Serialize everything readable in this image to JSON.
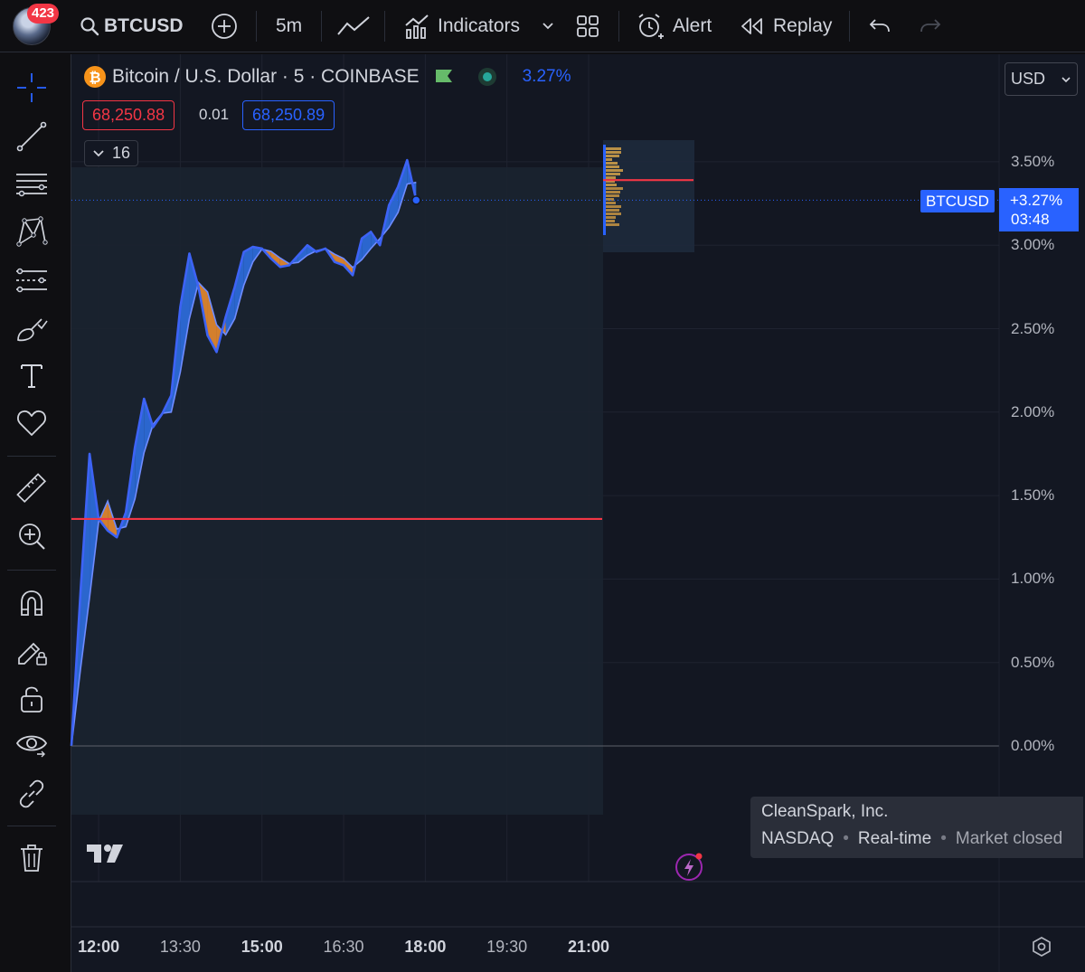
{
  "header": {
    "notification_count": "423",
    "symbol": "BTCUSD",
    "interval": "5m",
    "indicators_label": "Indicators",
    "alert_label": "Alert",
    "replay_label": "Replay"
  },
  "legend": {
    "title": "Bitcoin / U.S. Dollar · 5 · COINBASE",
    "change": "3.27%",
    "bid": "68,250.88",
    "spread": "0.01",
    "ask": "68,250.89",
    "indicator_count": "16"
  },
  "price_scale": {
    "currency": "USD",
    "labels": [
      "3.50%",
      "3.00%",
      "2.50%",
      "2.00%",
      "1.50%",
      "1.00%",
      "0.50%",
      "0.00%"
    ],
    "last_symbol": "BTCUSD",
    "last_change": "+3.27%",
    "countdown": "03:48"
  },
  "time_scale": {
    "labels": [
      {
        "text": "12:00",
        "bold": true
      },
      {
        "text": "13:30",
        "bold": false
      },
      {
        "text": "15:00",
        "bold": true
      },
      {
        "text": "16:30",
        "bold": false
      },
      {
        "text": "18:00",
        "bold": true
      },
      {
        "text": "19:30",
        "bold": false
      },
      {
        "text": "21:00",
        "bold": true
      }
    ]
  },
  "tooltip": {
    "company": "CleanSpark, Inc.",
    "exchange": "NASDAQ",
    "feed": "Real-time",
    "status": "Market closed"
  },
  "colors": {
    "up_fill": "#2e6ee0",
    "line": "#3d63f5",
    "down_fill": "#e8892d",
    "level": "#f23645",
    "badge": "#f23645",
    "accent": "#2962ff"
  },
  "chart_data": {
    "type": "area",
    "y_unit": "% change",
    "ylim": [
      0.0,
      3.5
    ],
    "x_range": [
      "11:30",
      "21:00"
    ],
    "series": [
      {
        "name": "BTCUSD",
        "points": [
          [
            "11:30",
            0.0
          ],
          [
            "11:40",
            0.92
          ],
          [
            "11:50",
            1.75
          ],
          [
            "12:00",
            1.36
          ],
          [
            "12:10",
            1.29
          ],
          [
            "12:20",
            1.25
          ],
          [
            "12:30",
            1.4
          ],
          [
            "12:40",
            1.79
          ],
          [
            "12:50",
            2.08
          ],
          [
            "13:00",
            1.91
          ],
          [
            "13:10",
            1.99
          ],
          [
            "13:20",
            2.1
          ],
          [
            "13:30",
            2.63
          ],
          [
            "13:40",
            2.95
          ],
          [
            "13:50",
            2.75
          ],
          [
            "14:00",
            2.46
          ],
          [
            "14:10",
            2.36
          ],
          [
            "14:20",
            2.57
          ],
          [
            "14:30",
            2.75
          ],
          [
            "14:40",
            2.96
          ],
          [
            "14:50",
            2.99
          ],
          [
            "15:00",
            2.98
          ],
          [
            "15:10",
            2.92
          ],
          [
            "15:20",
            2.87
          ],
          [
            "15:30",
            2.88
          ],
          [
            "15:40",
            2.94
          ],
          [
            "15:50",
            3.0
          ],
          [
            "16:00",
            2.96
          ],
          [
            "16:10",
            2.98
          ],
          [
            "16:20",
            2.9
          ],
          [
            "16:30",
            2.88
          ],
          [
            "16:40",
            2.82
          ],
          [
            "16:50",
            3.04
          ],
          [
            "17:00",
            3.08
          ],
          [
            "17:10",
            3.0
          ],
          [
            "17:20",
            3.24
          ],
          [
            "17:30",
            3.35
          ],
          [
            "17:40",
            3.51
          ],
          [
            "17:50",
            3.27
          ]
        ]
      }
    ],
    "annotations": [
      {
        "label": "session level",
        "y": 1.36
      },
      {
        "label": "volume profile level",
        "y": 3.39
      }
    ]
  }
}
